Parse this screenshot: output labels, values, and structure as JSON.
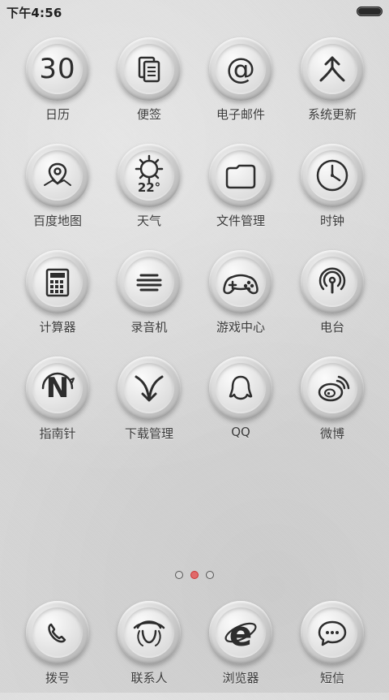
{
  "status": {
    "time": "下午4:56"
  },
  "apps": [
    {
      "label": "日历",
      "icon": "calendar-icon",
      "calendar_day": "30"
    },
    {
      "label": "便签",
      "icon": "notes-icon"
    },
    {
      "label": "电子邮件",
      "icon": "email-icon",
      "glyph": "@"
    },
    {
      "label": "系统更新",
      "icon": "system-update-icon"
    },
    {
      "label": "百度地图",
      "icon": "map-pin-icon"
    },
    {
      "label": "天气",
      "icon": "weather-sun-icon",
      "temperature": "22°"
    },
    {
      "label": "文件管理",
      "icon": "folder-icon"
    },
    {
      "label": "时钟",
      "icon": "clock-icon"
    },
    {
      "label": "计算器",
      "icon": "calculator-icon"
    },
    {
      "label": "录音机",
      "icon": "recorder-icon"
    },
    {
      "label": "游戏中心",
      "icon": "game-controller-icon"
    },
    {
      "label": "电台",
      "icon": "radio-icon"
    },
    {
      "label": "指南针",
      "icon": "compass-icon",
      "compass_letter": "N"
    },
    {
      "label": "下载管理",
      "icon": "download-icon"
    },
    {
      "label": "QQ",
      "icon": "qq-icon"
    },
    {
      "label": "微博",
      "icon": "weibo-icon"
    }
  ],
  "pager": {
    "pages": 3,
    "active_index": 1
  },
  "dock": [
    {
      "label": "拨号",
      "icon": "phone-icon"
    },
    {
      "label": "联系人",
      "icon": "contacts-icon"
    },
    {
      "label": "浏览器",
      "icon": "browser-icon",
      "glyph": "e"
    },
    {
      "label": "短信",
      "icon": "sms-icon"
    }
  ],
  "colors": {
    "wallpaper": "#d9d9d9",
    "label_text": "#3b3b3b",
    "active_dot": "#e06a6a"
  }
}
